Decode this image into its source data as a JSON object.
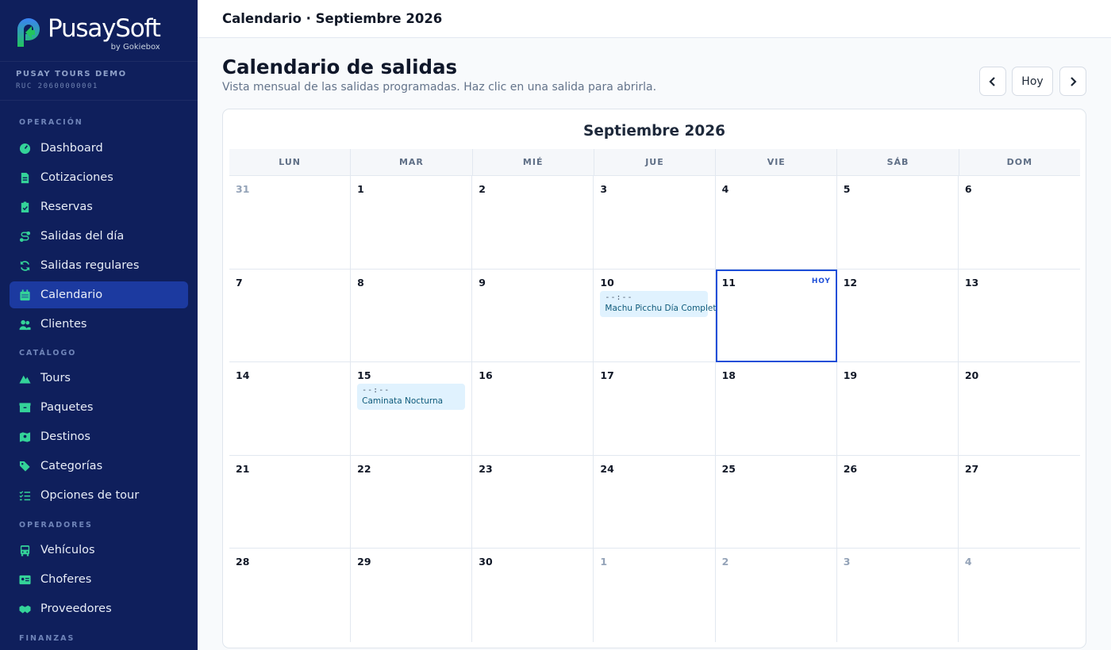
{
  "brand": {
    "name": "PusaySoft",
    "by": "by Gokiebox"
  },
  "tenant": {
    "name": "PUSAY TOURS DEMO",
    "ruc": "RUC 20600000001"
  },
  "sidebar": {
    "sections": [
      {
        "title": "OPERACIÓN",
        "items": [
          {
            "label": "Dashboard",
            "icon": "gauge-icon"
          },
          {
            "label": "Cotizaciones",
            "icon": "file-invoice-icon"
          },
          {
            "label": "Reservas",
            "icon": "clipboard-check-icon"
          },
          {
            "label": "Salidas del día",
            "icon": "route-icon"
          },
          {
            "label": "Salidas regulares",
            "icon": "refresh-icon"
          },
          {
            "label": "Calendario",
            "icon": "calendar-icon",
            "active": true
          },
          {
            "label": "Clientes",
            "icon": "users-icon"
          }
        ]
      },
      {
        "title": "CATÁLOGO",
        "items": [
          {
            "label": "Tours",
            "icon": "mountain-icon"
          },
          {
            "label": "Paquetes",
            "icon": "box-icon"
          },
          {
            "label": "Destinos",
            "icon": "map-pin-icon"
          },
          {
            "label": "Categorías",
            "icon": "tags-icon"
          },
          {
            "label": "Opciones de tour",
            "icon": "list-check-icon"
          }
        ]
      },
      {
        "title": "OPERADORES",
        "items": [
          {
            "label": "Vehículos",
            "icon": "bus-icon"
          },
          {
            "label": "Choferes",
            "icon": "id-card-icon"
          },
          {
            "label": "Proveedores",
            "icon": "handshake-icon"
          }
        ]
      },
      {
        "title": "FINANZAS",
        "items": []
      }
    ]
  },
  "topbar": {
    "title": "Calendario · Septiembre 2026"
  },
  "header": {
    "title": "Calendario de salidas",
    "subtitle": "Vista mensual de las salidas programadas. Haz clic en una salida para abrirla.",
    "prev_icon": "chevron-left-icon",
    "today_label": "Hoy",
    "next_icon": "chevron-right-icon"
  },
  "calendar": {
    "month_title": "Septiembre 2026",
    "weekdays": [
      "LUN",
      "MAR",
      "MIÉ",
      "JUE",
      "VIE",
      "SÁB",
      "DOM"
    ],
    "today_badge": "HOY",
    "days": [
      {
        "num": "31",
        "other": true
      },
      {
        "num": "1"
      },
      {
        "num": "2"
      },
      {
        "num": "3"
      },
      {
        "num": "4"
      },
      {
        "num": "5"
      },
      {
        "num": "6"
      },
      {
        "num": "7"
      },
      {
        "num": "8"
      },
      {
        "num": "9"
      },
      {
        "num": "10",
        "events": [
          {
            "time": "--:--",
            "name": "Machu Picchu Día Completo"
          }
        ]
      },
      {
        "num": "11",
        "today": true
      },
      {
        "num": "12"
      },
      {
        "num": "13"
      },
      {
        "num": "14"
      },
      {
        "num": "15",
        "events": [
          {
            "time": "--:--",
            "name": "Caminata Nocturna"
          }
        ]
      },
      {
        "num": "16"
      },
      {
        "num": "17"
      },
      {
        "num": "18"
      },
      {
        "num": "19"
      },
      {
        "num": "20"
      },
      {
        "num": "21"
      },
      {
        "num": "22"
      },
      {
        "num": "23"
      },
      {
        "num": "24"
      },
      {
        "num": "25"
      },
      {
        "num": "26"
      },
      {
        "num": "27"
      },
      {
        "num": "28"
      },
      {
        "num": "29"
      },
      {
        "num": "30"
      },
      {
        "num": "1",
        "other": true
      },
      {
        "num": "2",
        "other": true
      },
      {
        "num": "3",
        "other": true
      },
      {
        "num": "4",
        "other": true
      }
    ]
  },
  "colors": {
    "sidebar_bg": "#0f1f5c",
    "active_nav": "#1c3aa0",
    "icon_accent": "#34d399",
    "today_border": "#1d4ed8",
    "event_bg": "#e0f2fe"
  }
}
